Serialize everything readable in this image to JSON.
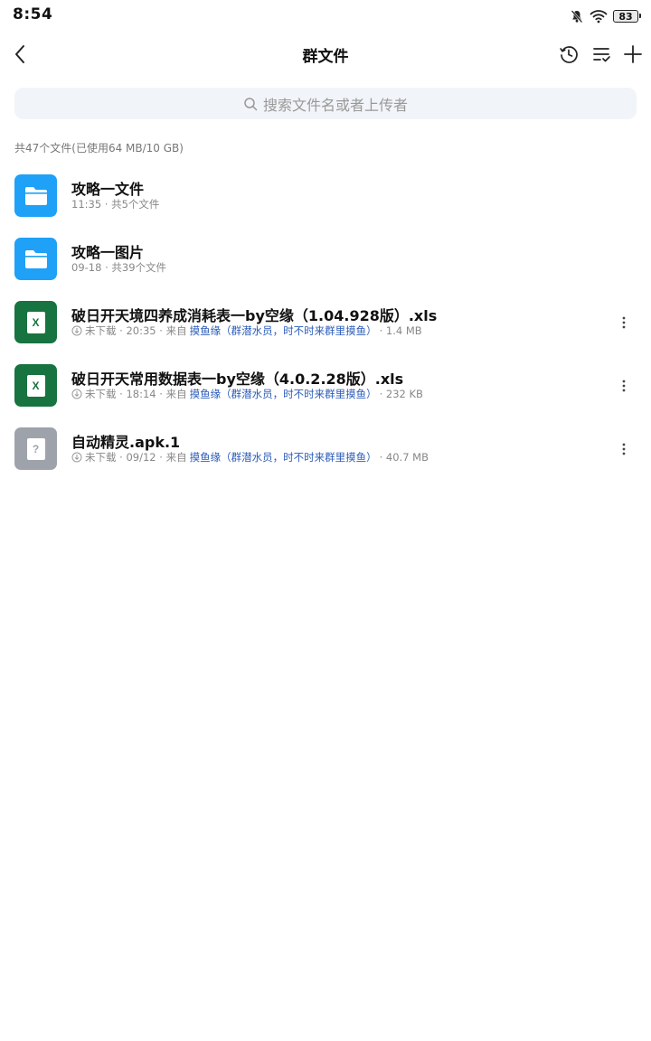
{
  "status_bar": {
    "time": "8:54",
    "battery": "83",
    "icons": [
      "bell-muted-icon",
      "wifi-icon",
      "battery-icon"
    ]
  },
  "header": {
    "title": "群文件",
    "actions": [
      "history-icon",
      "sort-icon",
      "plus-icon"
    ]
  },
  "search": {
    "placeholder": "搜索文件名或者上传者"
  },
  "summary": "共47个文件(已使用64 MB/10 GB)",
  "files": [
    {
      "type": "folder",
      "name": "攻略一文件",
      "meta": "11:35 · 共5个文件"
    },
    {
      "type": "folder",
      "name": "攻略一图片",
      "meta": "09-18 · 共39个文件"
    },
    {
      "type": "excel",
      "icon_label": "X",
      "name": "破日开天境四养成消耗表一by空缘（1.04.928版）.xls",
      "status": "未下载",
      "time": "20:35",
      "from_label": "来自",
      "uploader": "摸鱼缘（群潜水员，时不时来群里摸鱼）",
      "size": "1.4 MB"
    },
    {
      "type": "excel",
      "icon_label": "X",
      "name": "破日开天常用数据表一by空缘（4.0.2.28版）.xls",
      "status": "未下载",
      "time": "18:14",
      "from_label": "来自",
      "uploader": "摸鱼缘（群潜水员，时不时来群里摸鱼）",
      "size": "232 KB"
    },
    {
      "type": "unknown",
      "icon_label": "?",
      "name": "自动精灵.apk.1",
      "status": "未下载",
      "time": "09/12",
      "from_label": "来自",
      "uploader": "摸鱼缘（群潜水员，时不时来群里摸鱼）",
      "size": "40.7 MB"
    }
  ],
  "colors": {
    "folder": "#1ea1f7",
    "excel": "#17733f",
    "unknown": "#9ea3ab",
    "uploader_link": "#2a5bb8"
  }
}
